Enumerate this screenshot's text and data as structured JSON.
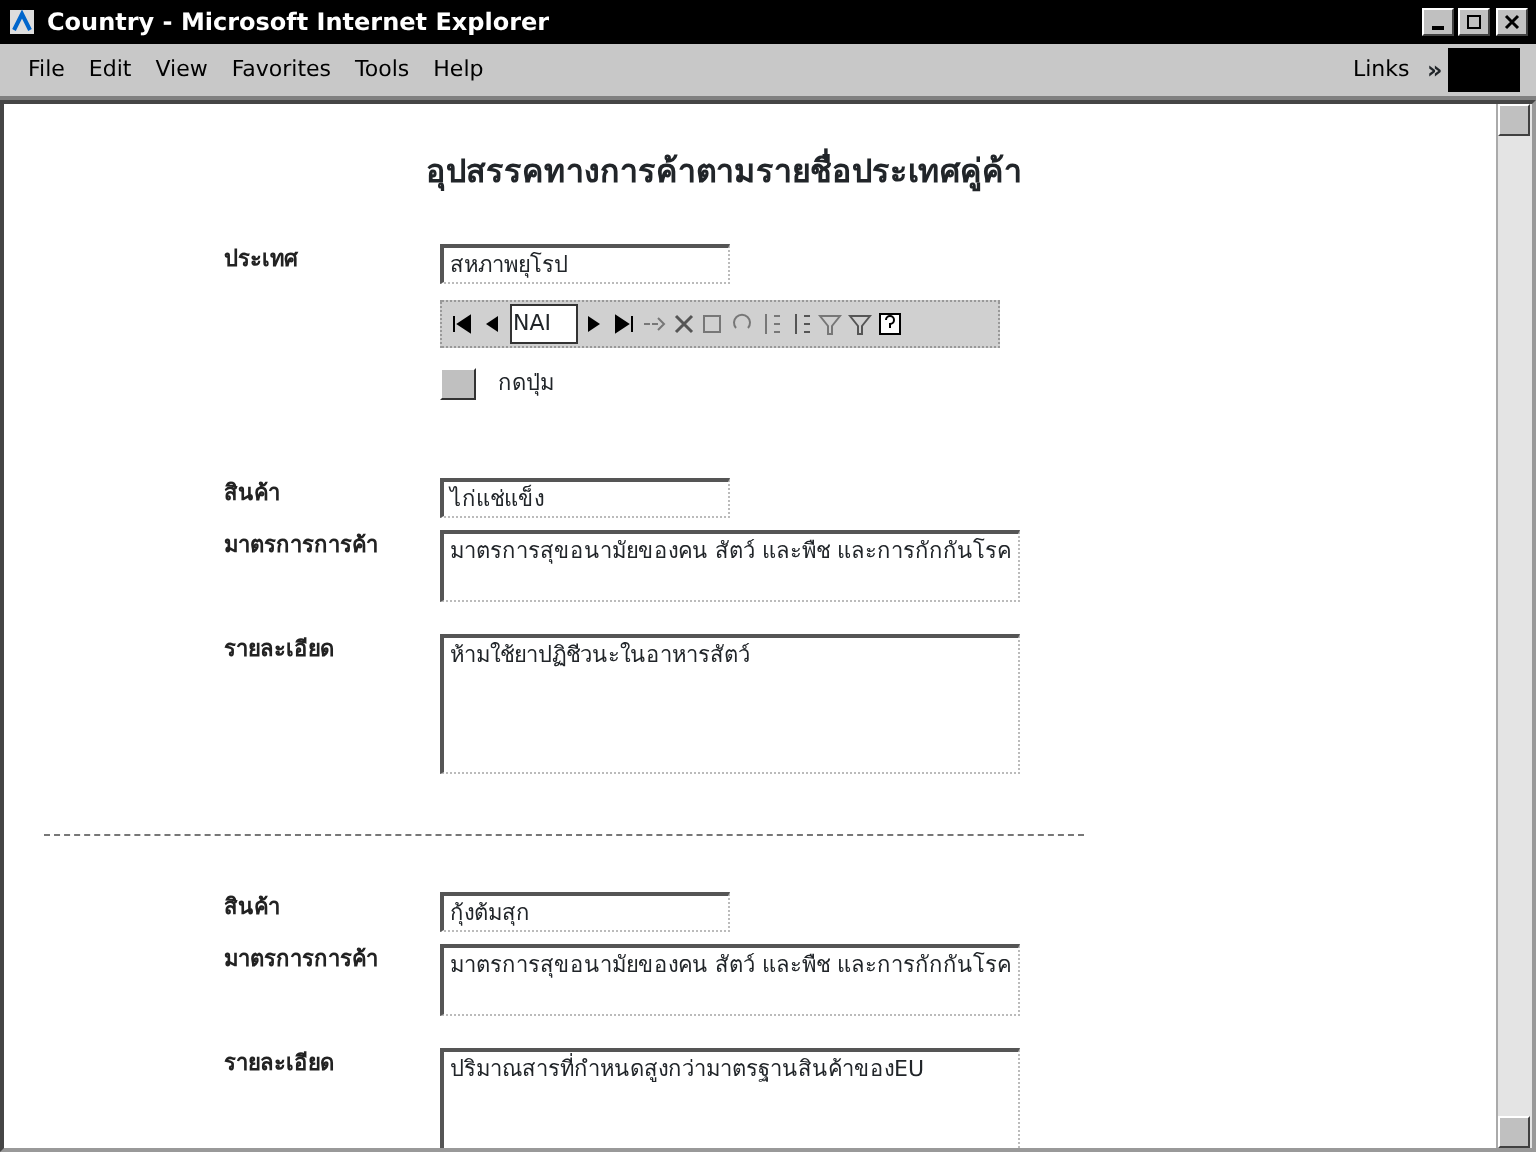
{
  "window": {
    "title": "Country - Microsoft Internet Explorer"
  },
  "menu": [
    "File",
    "Edit",
    "View",
    "Favorites",
    "Tools",
    "Help"
  ],
  "links": {
    "label": "Links",
    "chevron": "»"
  },
  "page": {
    "title": "อุปสรรคทางการค้าตามรายชื่อประเทศคู่ค้า",
    "country": {
      "label": "ประเทศ",
      "value": "สหภาพยุโรป"
    },
    "navigator": {
      "record": "NAI"
    },
    "action": {
      "label": "กดปุ่ม"
    },
    "records": [
      {
        "product_label": "สินค้า",
        "product": "ไก่แช่แข็ง",
        "measure_label": "มาตรการการค้า",
        "measure": "มาตรการสุขอนามัยของคน สัตว์ และพืช และการกักกันโรค",
        "detail_label": "รายละเอียด",
        "detail": "ห้ามใช้ยาปฏิชีวนะในอาหารสัตว์"
      },
      {
        "product_label": "สินค้า",
        "product": "กุ้งต้มสุก",
        "measure_label": "มาตรการการค้า",
        "measure": "มาตรการสุขอนามัยของคน สัตว์ และพืช และการกักกันโรค",
        "detail_label": "รายละเอียด",
        "detail": "ปริมาณสารที่กำหนดสูงกว่ามาตรฐานสินค้าของEU"
      }
    ]
  }
}
